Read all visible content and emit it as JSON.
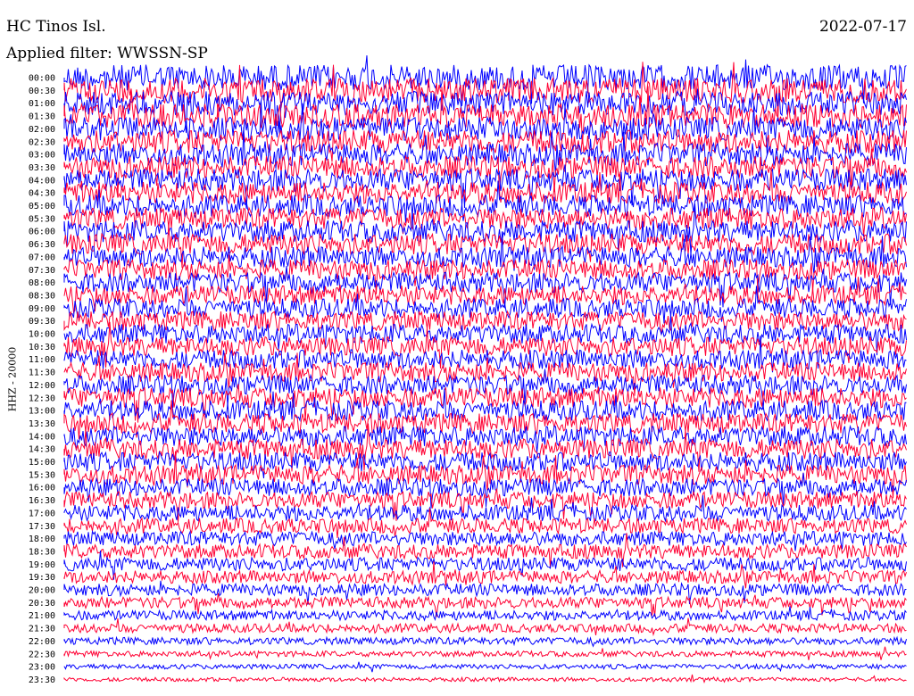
{
  "header": {
    "station": "HC Tinos Isl.",
    "date": "2022-07-17",
    "filter": "Applied filter: WWSSN-SP",
    "channel": "HHZ - 20000"
  },
  "colors": {
    "trace_a": "#0000ff",
    "trace_b": "#ff0033",
    "background": "#ffffff"
  },
  "chart_data": {
    "type": "line",
    "title": "HC Tinos Isl.",
    "ylabel": "HHZ - 20000",
    "y_tick_labels": [
      "00:00",
      "00:30",
      "01:00",
      "01:30",
      "02:00",
      "02:30",
      "03:00",
      "03:30",
      "04:00",
      "04:30",
      "05:00",
      "05:30",
      "06:00",
      "06:30",
      "07:00",
      "07:30",
      "08:00",
      "08:30",
      "09:00",
      "09:30",
      "10:00",
      "10:30",
      "11:00",
      "11:30",
      "12:00",
      "12:30",
      "13:00",
      "13:30",
      "14:00",
      "14:30",
      "15:00",
      "15:30",
      "16:00",
      "16:30",
      "17:00",
      "17:30",
      "18:00",
      "18:30",
      "19:00",
      "19:30",
      "20:00",
      "20:30",
      "21:00",
      "21:30",
      "22:00",
      "22:30",
      "23:00",
      "23:30"
    ],
    "series_colors_alternating": [
      "#0000ff",
      "#ff0033"
    ],
    "relative_noise_amplitude": [
      1.6,
      1.55,
      1.5,
      1.5,
      1.45,
      1.45,
      1.4,
      1.4,
      1.4,
      1.35,
      1.35,
      1.35,
      1.35,
      1.3,
      1.3,
      1.25,
      1.25,
      1.2,
      1.2,
      1.2,
      1.2,
      1.2,
      1.2,
      1.2,
      1.2,
      1.25,
      1.25,
      1.25,
      1.25,
      1.25,
      1.2,
      1.2,
      1.1,
      1.05,
      1.0,
      0.95,
      0.9,
      0.9,
      0.85,
      0.8,
      0.75,
      0.7,
      0.6,
      0.55,
      0.45,
      0.35,
      0.3,
      0.25
    ],
    "grid": false,
    "legend": "none"
  }
}
